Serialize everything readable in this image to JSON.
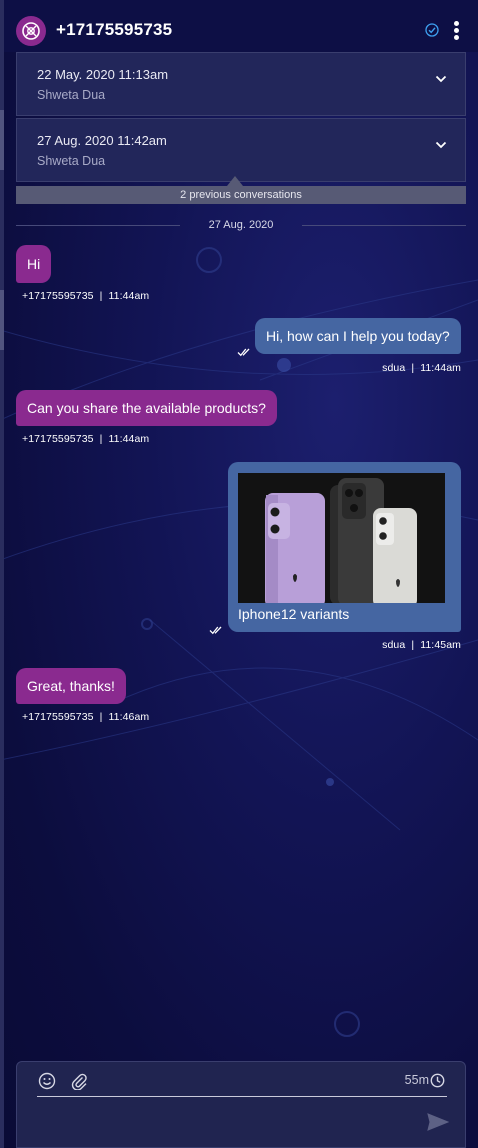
{
  "header": {
    "title": "+17175595735",
    "verified_icon": "check-circle-icon",
    "menu_icon": "kebab-menu-icon"
  },
  "previous_conversations": [
    {
      "date": "22 May. 2020 11:13am",
      "agent": "Shweta Dua"
    },
    {
      "date": "27 Aug. 2020 11:42am",
      "agent": "Shweta Dua"
    }
  ],
  "previous_label": "2 previous conversations",
  "date_separator": "27 Aug. 2020",
  "messages": [
    {
      "direction": "in",
      "text": "Hi",
      "meta": "+17175595735  |  11:44am"
    },
    {
      "direction": "out",
      "text": "Hi, how can I help you today?",
      "meta": "sdua  |  11:44am"
    },
    {
      "direction": "in",
      "text": "Can you share the available products?",
      "meta": "+17175595735  |  11:44am"
    },
    {
      "direction": "out",
      "type": "image",
      "caption": "Iphone12 variants",
      "meta": "sdua  |  11:45am"
    },
    {
      "direction": "in",
      "text": "Great, thanks!",
      "meta": "+17175595735  |  11:46am"
    }
  ],
  "composer": {
    "timer": "55m",
    "emoji_icon": "emoji-icon",
    "attach_icon": "paperclip-icon",
    "clock_icon": "clock-icon",
    "send_icon": "send-icon"
  },
  "colors": {
    "incoming_bubble": "#8a2a8f",
    "outgoing_bubble": "#4566a2",
    "background": "#121454",
    "accent_check": "#3ea0f0"
  }
}
